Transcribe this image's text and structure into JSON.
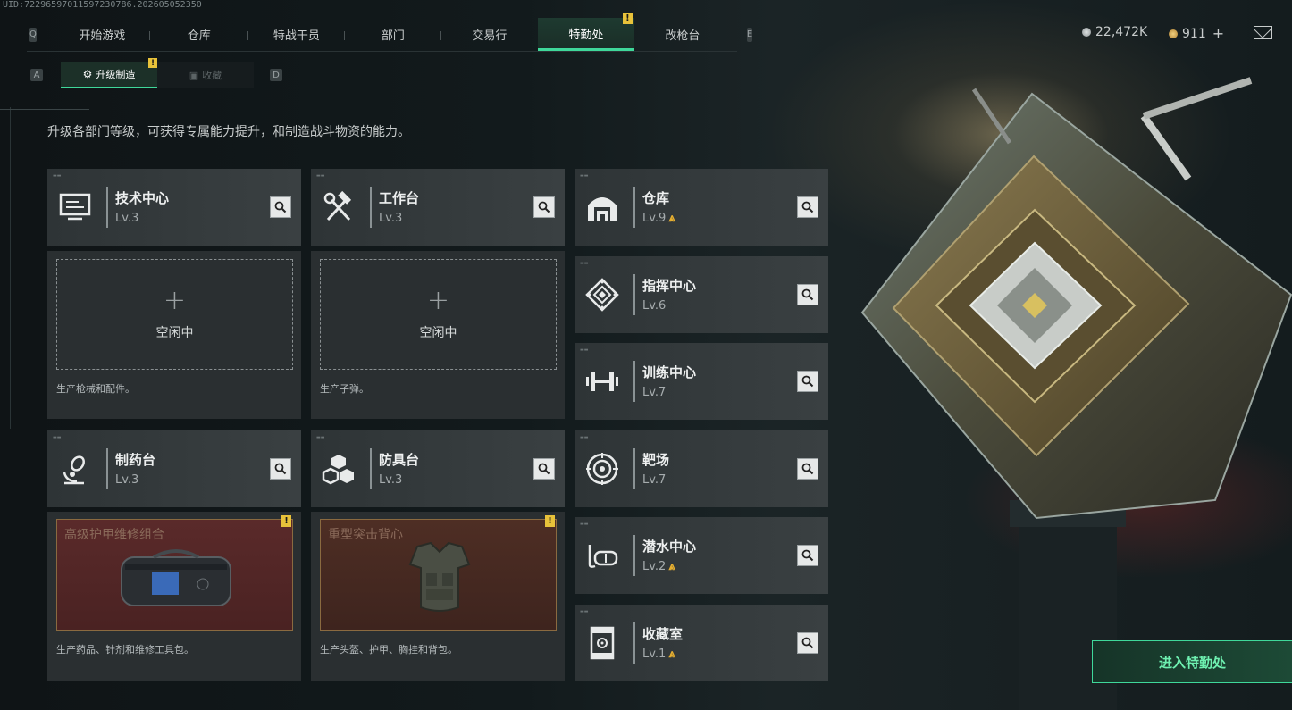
{
  "uid": "UID:72296597011597230786.202605052350",
  "nav": {
    "key_left": "Q",
    "key_right": "E",
    "tabs": [
      "开始游戏",
      "仓库",
      "特战干员",
      "部门",
      "交易行",
      "特勤处",
      "改枪台"
    ],
    "active_index": 5
  },
  "subnav": {
    "key_left": "A",
    "key_right": "D",
    "tabs": [
      "升级制造",
      "收藏"
    ]
  },
  "currency": {
    "silver": "22,472K",
    "gold": "911",
    "gold_add": "+"
  },
  "description": "升级各部门等级，可获得专属能力提升，和制造战斗物资的能力。",
  "badge_text": "!",
  "depts": {
    "tech": {
      "name": "技术中心",
      "level": "Lv.3",
      "idle": "空闲中",
      "desc": "生产枪械和配件。"
    },
    "workbench": {
      "name": "工作台",
      "level": "Lv.3",
      "idle": "空闲中",
      "desc": "生产子弹。"
    },
    "pharmacy": {
      "name": "制药台",
      "level": "Lv.3",
      "product": "高级护甲维修组合",
      "desc": "生产药品、针剂和维修工具包。"
    },
    "armor": {
      "name": "防具台",
      "level": "Lv.3",
      "product": "重型突击背心",
      "desc": "生产头盔、护甲、胸挂和背包。"
    },
    "warehouse": {
      "name": "仓库",
      "level": "Lv.9",
      "upgrade": true
    },
    "command": {
      "name": "指挥中心",
      "level": "Lv.6"
    },
    "training": {
      "name": "训练中心",
      "level": "Lv.7"
    },
    "range": {
      "name": "靶场",
      "level": "Lv.7"
    },
    "diving": {
      "name": "潜水中心",
      "level": "Lv.2",
      "upgrade": true
    },
    "collection": {
      "name": "收藏室",
      "level": "Lv.1",
      "upgrade": true
    }
  },
  "upgrade_icon": "⩓",
  "enter_button": "进入特勤处",
  "colors": {
    "accent": "#3fd89a",
    "badge": "#e8c23a",
    "upgrade": "#e8b030"
  }
}
